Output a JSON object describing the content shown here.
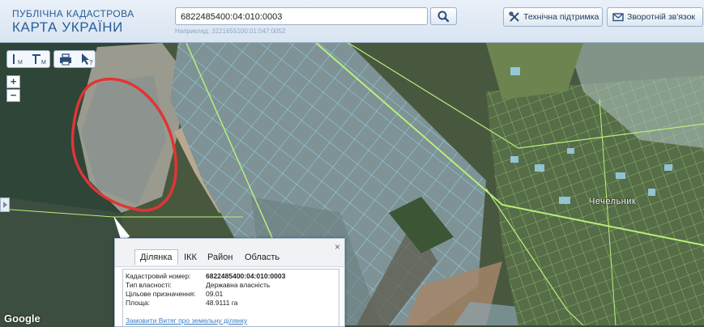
{
  "header": {
    "logo_line1": "ПУБЛІЧНА КАДАСТРОВА",
    "logo_line2": "КАРТА УКРАЇНИ",
    "search_value": "6822485400:04:010:0003",
    "search_hint": "Наприклад: 3221655100:01:047:0052",
    "support_label": "Технічна підтримка",
    "feedback_label": "Зворотній зв'язок"
  },
  "map": {
    "attribution": "Google",
    "village_label": "Чечельник",
    "colors": {
      "parcel_border": "#8fe4ff",
      "road": "#b8f07a",
      "highlight": "#e03535"
    }
  },
  "popup": {
    "tabs": [
      "Ділянка",
      "ІКК",
      "Район",
      "Область"
    ],
    "close": "×",
    "rows": [
      {
        "key": "Кадастровий номер:",
        "value": "6822485400:04:010:0003"
      },
      {
        "key": "Тип власності:",
        "value": "Державна власність"
      },
      {
        "key": "Цільове призначення:",
        "value": "09.01"
      },
      {
        "key": "Площа:",
        "value": "48.9111 га"
      }
    ],
    "link": "Замовити Витяг про земельну ділянку"
  }
}
